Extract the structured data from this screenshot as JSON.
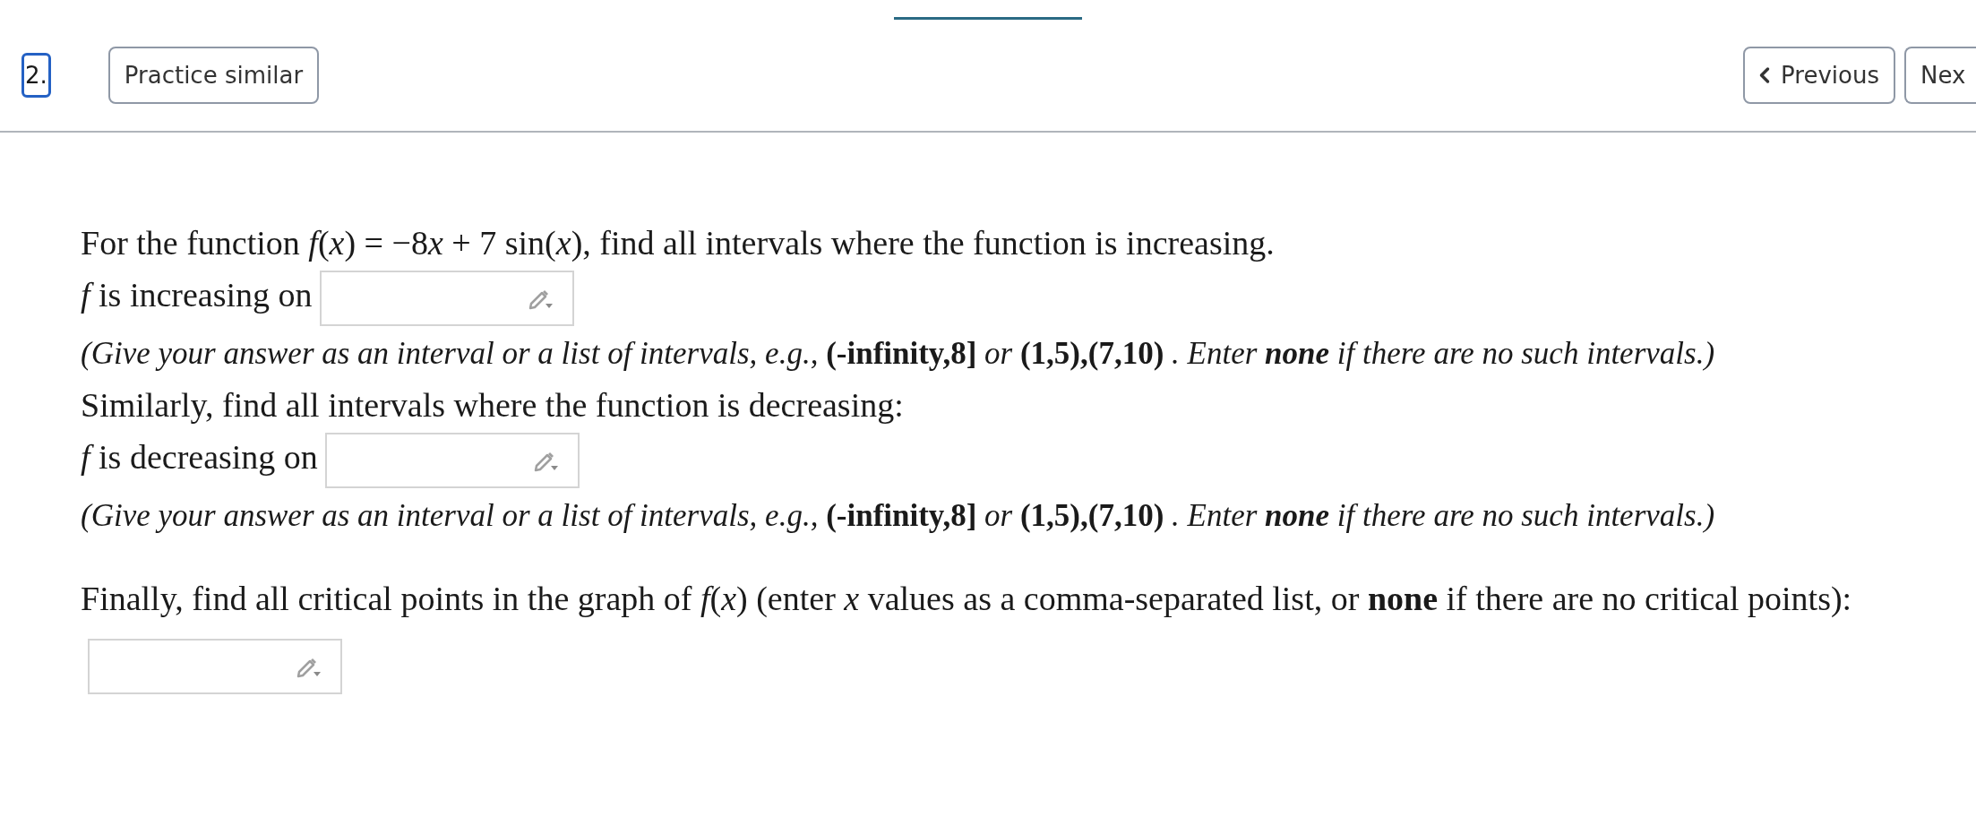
{
  "header": {
    "problem_number": "2.",
    "practice_button": "Practice similar",
    "previous_button": "Previous",
    "next_button": "Nex"
  },
  "problem": [
    {
      "kind": "text",
      "segments": [
        {
          "kind": "text",
          "text": "For the function "
        },
        {
          "kind": "var",
          "text": "f"
        },
        {
          "kind": "text",
          "text": "("
        },
        {
          "kind": "var",
          "text": "x"
        },
        {
          "kind": "text",
          "text": ") = −8"
        },
        {
          "kind": "var",
          "text": "x"
        },
        {
          "kind": "text",
          "text": " + 7 sin("
        },
        {
          "kind": "var",
          "text": "x"
        },
        {
          "kind": "text",
          "text": ")"
        },
        {
          "kind": "text",
          "text": ", find all intervals where the function is increasing."
        }
      ]
    },
    {
      "kind": "answer",
      "segments": [
        {
          "kind": "math",
          "text": "*f*"
        },
        {
          "kind": "text",
          "text": " is increasing on"
        }
      ]
    },
    {
      "kind": "text",
      "segments": [
        {
          "kind": "italic",
          "text": "(Give your answer as an interval or a list of intervals, e.g., "
        },
        {
          "kind": "code",
          "text": "(-infinity,8]"
        },
        {
          "kind": "italic",
          "text": " or "
        },
        {
          "kind": "code",
          "text": "(1,5),(7,10)"
        },
        {
          "kind": "italic",
          "text": " . Enter "
        },
        {
          "kind": "strong_italic",
          "text": "none"
        },
        {
          "kind": "italic",
          "text": " if there are no such intervals.)"
        }
      ]
    },
    {
      "kind": "text",
      "segments": [
        {
          "kind": "text",
          "text": "Similarly, find all intervals where the function is decreasing:"
        }
      ]
    },
    {
      "kind": "answer",
      "segments": [
        {
          "kind": "math",
          "text": "*f*"
        },
        {
          "kind": "text",
          "text": " is decreasing on"
        }
      ]
    },
    {
      "kind": "text",
      "segments": [
        {
          "kind": "italic",
          "text": "(Give your answer as an interval or a list of intervals, e.g., "
        },
        {
          "kind": "code",
          "text": "(-infinity,8]"
        },
        {
          "kind": "italic",
          "text": " or "
        },
        {
          "kind": "code",
          "text": "(1,5),(7,10)"
        },
        {
          "kind": "italic",
          "text": " . Enter "
        },
        {
          "kind": "strong_italic",
          "text": "none"
        },
        {
          "kind": "italic",
          "text": " if there are no such intervals.)"
        }
      ]
    },
    {
      "kind": "answer",
      "segments": [
        {
          "kind": "text",
          "text": "Finally, find all critical points in the graph of "
        },
        {
          "kind": "math",
          "text": "*f*(*x*)"
        },
        {
          "kind": "text",
          "text": " (enter "
        },
        {
          "kind": "math",
          "text": "*x*"
        },
        {
          "kind": "text",
          "text": " values as a comma-separated list, or "
        },
        {
          "kind": "strong",
          "text": "none"
        },
        {
          "kind": "text",
          "text": " if there are no critical points):"
        }
      ]
    }
  ]
}
